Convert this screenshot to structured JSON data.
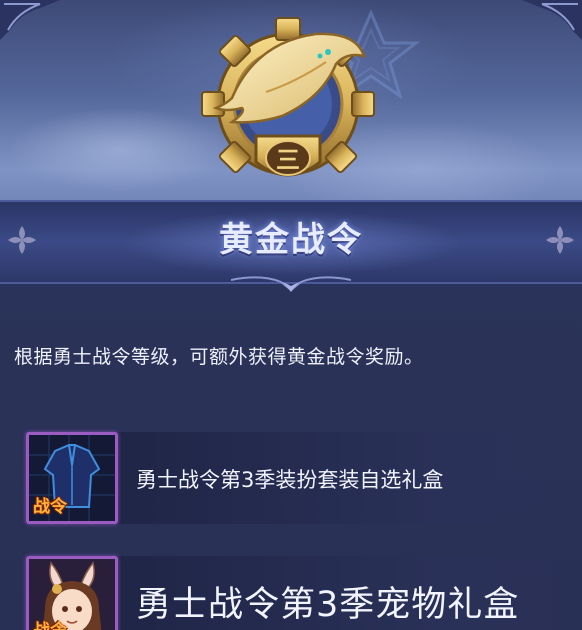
{
  "title": "黄金战令",
  "medal": {
    "rank_numeral": "三",
    "icon": "golden-whale-medal-icon"
  },
  "description": "根据勇士战令等级，可额外获得黄金战令奖励。",
  "rewards": [
    {
      "icon": "armor-outfit-icon",
      "tag": "战令",
      "label": "勇士战令第3季装扮套装自选礼盒",
      "frame_color": "#9a5cc0"
    },
    {
      "icon": "bunny-girl-pet-icon",
      "tag": "战令",
      "label": "勇士战令第3季宠物礼盒",
      "frame_color": "#9a5cc0"
    }
  ],
  "colors": {
    "title_text": "#e8ecff",
    "tag_text": "#ffb23a",
    "panel_bg": "#2a3359",
    "medal_gold": "#d9b25a"
  }
}
